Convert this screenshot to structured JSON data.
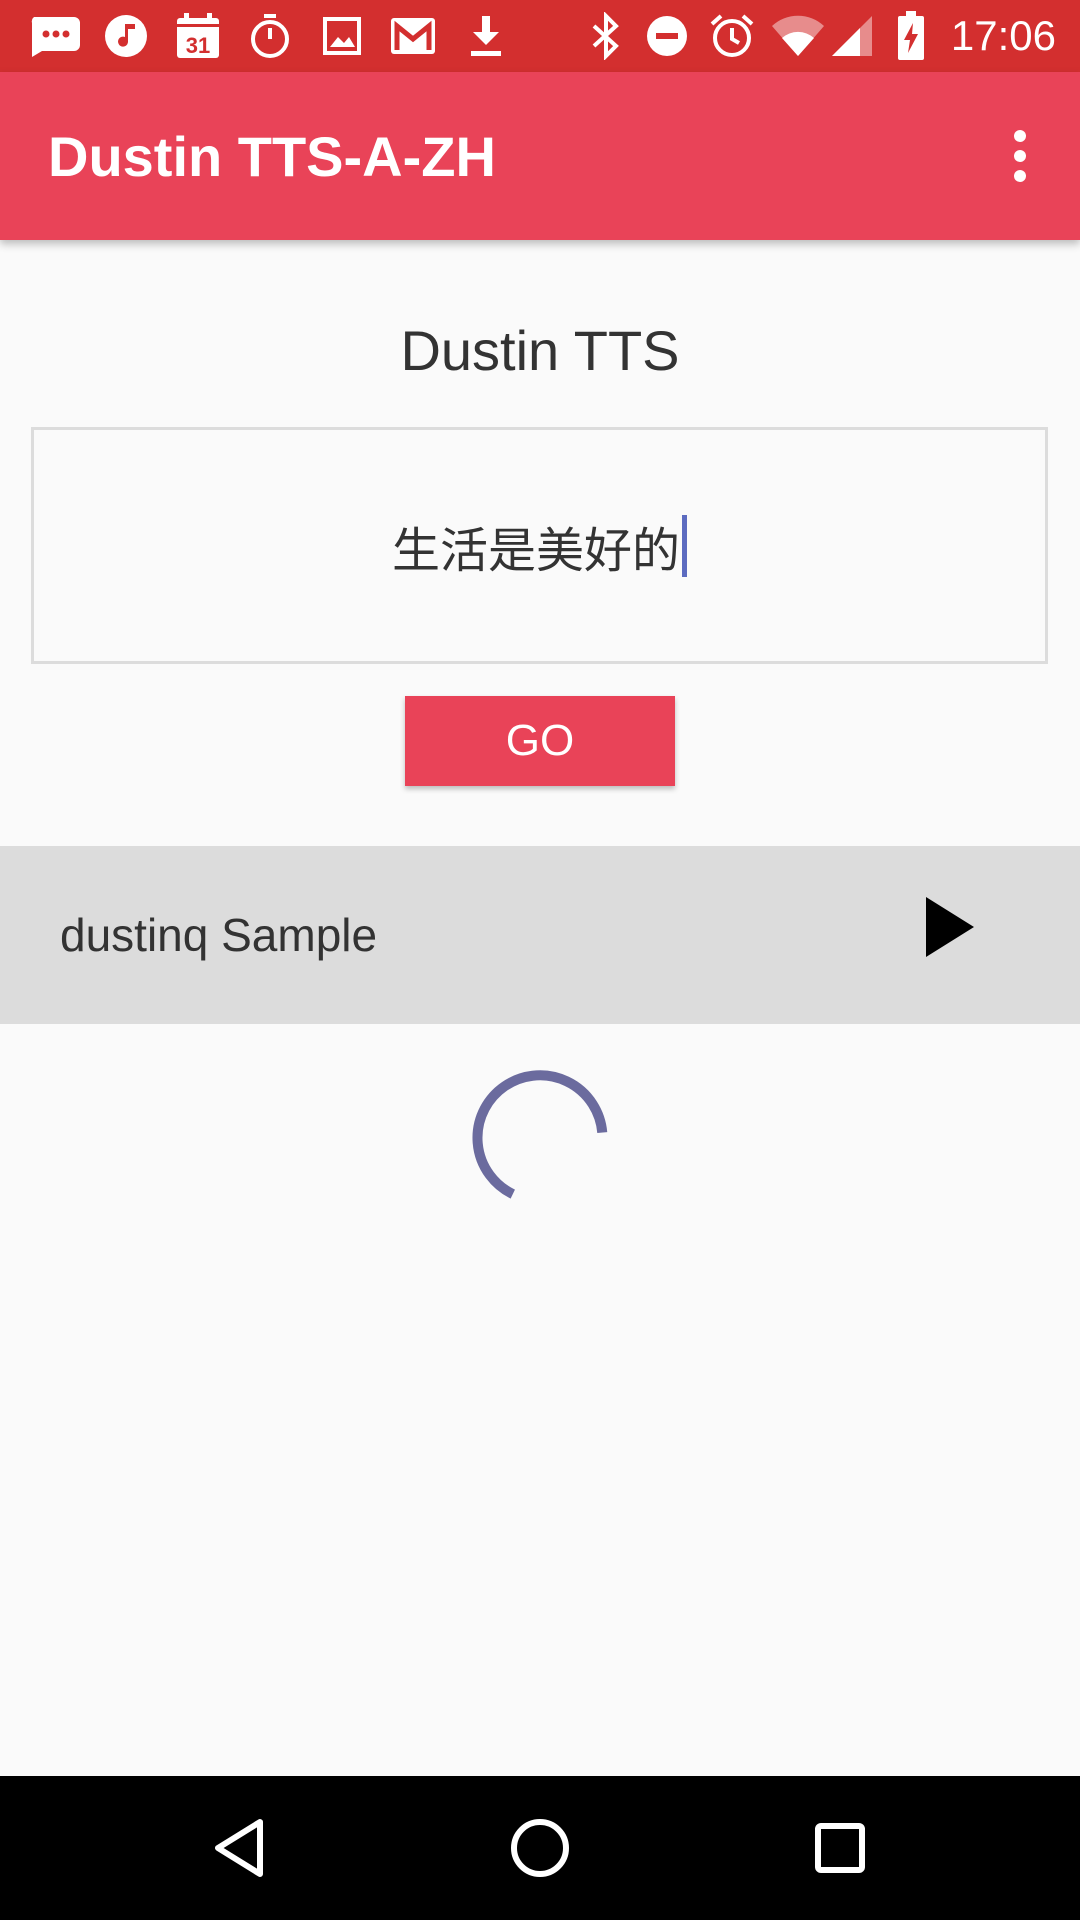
{
  "status_bar": {
    "time": "17:06",
    "calendar_day": "31",
    "left_icons": [
      "messaging-icon",
      "music-icon",
      "calendar-icon",
      "stopwatch-icon",
      "image-icon",
      "gmail-icon",
      "download-icon"
    ],
    "right_icons": [
      "bluetooth-icon",
      "do-not-disturb-icon",
      "alarm-icon",
      "wifi-icon",
      "cellular-signal-icon",
      "battery-charging-icon"
    ]
  },
  "app_bar": {
    "title": "Dustin TTS-A-ZH",
    "menu_icon": "more-vert-icon"
  },
  "main": {
    "heading": "Dustin TTS",
    "input": {
      "value": "生活是美好的"
    },
    "go_button_label": "GO",
    "sample": {
      "label": "dustinq Sample",
      "play_icon": "play-icon"
    },
    "spinner_icon": "loading-spinner-icon"
  },
  "nav_bar": {
    "icons": [
      "back-icon",
      "home-icon",
      "recents-icon"
    ]
  },
  "colors": {
    "status_bar": "#d32f2f",
    "accent": "#e94358",
    "spinner": "#6b6b9e",
    "sample_row": "#dcdcdc",
    "background": "#fafafa"
  }
}
